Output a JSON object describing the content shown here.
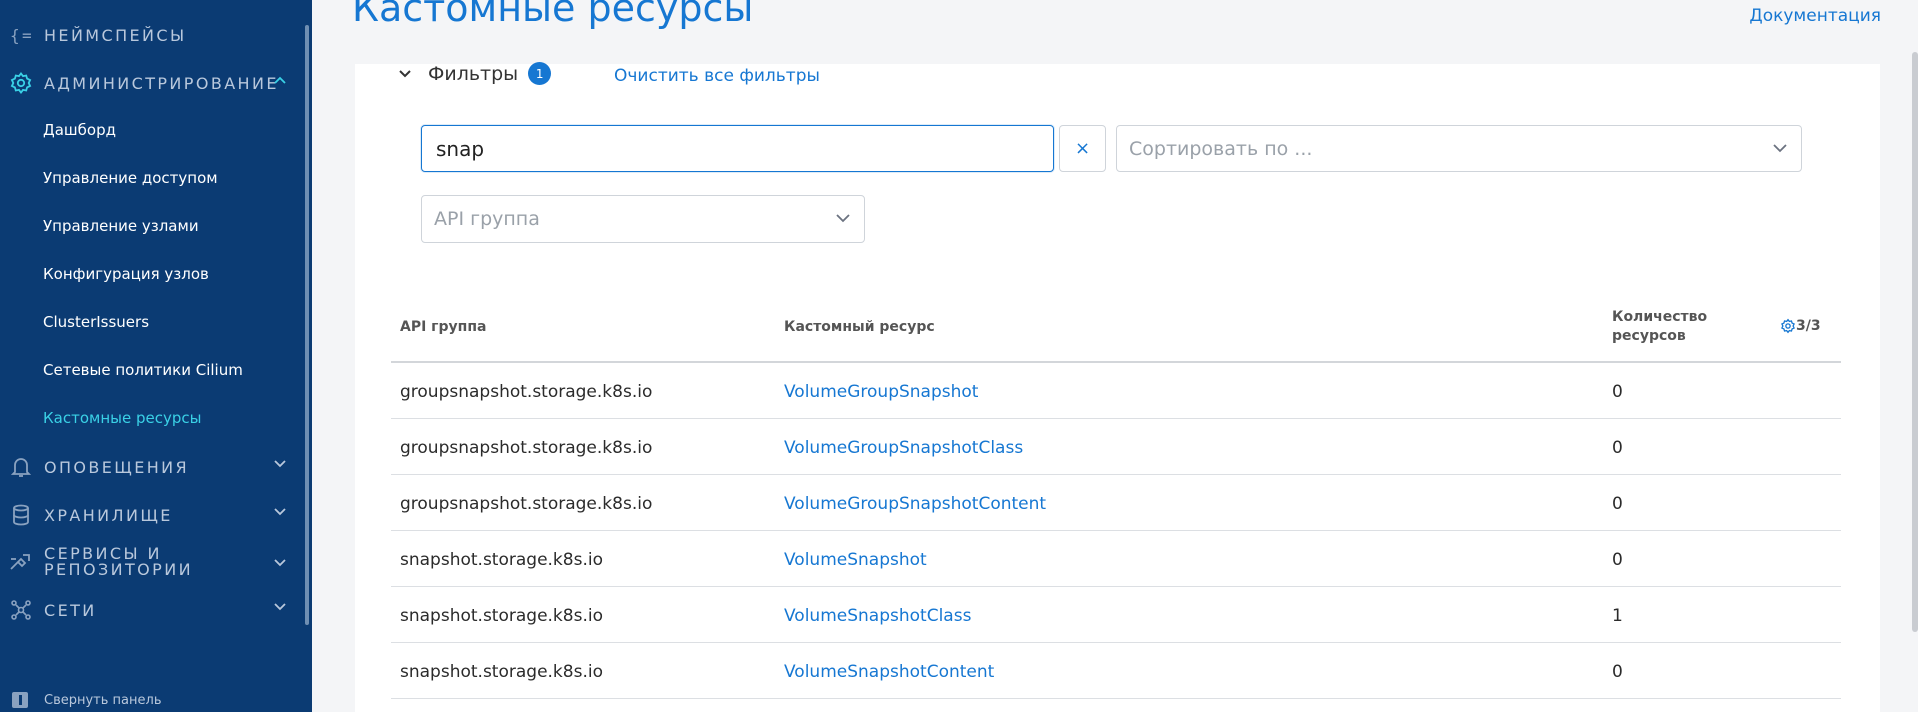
{
  "sidebar": {
    "sections": [
      {
        "label": "Неймспейсы",
        "icon": "braces-icon"
      },
      {
        "label": "Администрирование",
        "icon": "gear-icon"
      },
      {
        "label": "Оповещения",
        "icon": "bell-icon"
      },
      {
        "label": "Хранилище",
        "icon": "database-icon"
      },
      {
        "label": "Сервисы и репозитории",
        "line1": "Сервисы и",
        "line2": "репозитории",
        "icon": "tools-icon"
      },
      {
        "label": "Сети",
        "icon": "network-icon"
      }
    ],
    "admin_items": [
      {
        "label": "Дашборд"
      },
      {
        "label": "Управление доступом"
      },
      {
        "label": "Управление узлами"
      },
      {
        "label": "Конфигурация узлов"
      },
      {
        "label": "ClusterIssuers"
      },
      {
        "label": "Сетевые политики Cilium"
      },
      {
        "label": "Кастомные ресурсы",
        "active": true
      }
    ],
    "collapse_label": "Свернуть панель"
  },
  "header": {
    "title": "Кастомные ресурсы",
    "doc_link": "Документация"
  },
  "filters": {
    "label": "Фильтры",
    "count": "1",
    "clear_all": "Очистить все фильтры",
    "search_value": "snap",
    "clear_symbol": "×",
    "sort_placeholder": "Сортировать по ...",
    "api_group_placeholder": "API группа"
  },
  "table": {
    "columns": [
      "API группа",
      "Кастомный ресурс",
      "Количество",
      "ресурсов"
    ],
    "column_control": "3/3",
    "rows": [
      {
        "group": "groupsnapshot.storage.k8s.io",
        "resource": "VolumeGroupSnapshot",
        "count": "0"
      },
      {
        "group": "groupsnapshot.storage.k8s.io",
        "resource": "VolumeGroupSnapshotClass",
        "count": "0"
      },
      {
        "group": "groupsnapshot.storage.k8s.io",
        "resource": "VolumeGroupSnapshotContent",
        "count": "0"
      },
      {
        "group": "snapshot.storage.k8s.io",
        "resource": "VolumeSnapshot",
        "count": "0"
      },
      {
        "group": "snapshot.storage.k8s.io",
        "resource": "VolumeSnapshotClass",
        "count": "1"
      },
      {
        "group": "snapshot.storage.k8s.io",
        "resource": "VolumeSnapshotContent",
        "count": "0"
      }
    ]
  },
  "colors": {
    "sidebar_bg": "#0b3b73",
    "accent": "#1677d2",
    "active_item": "#3ad1e6"
  }
}
